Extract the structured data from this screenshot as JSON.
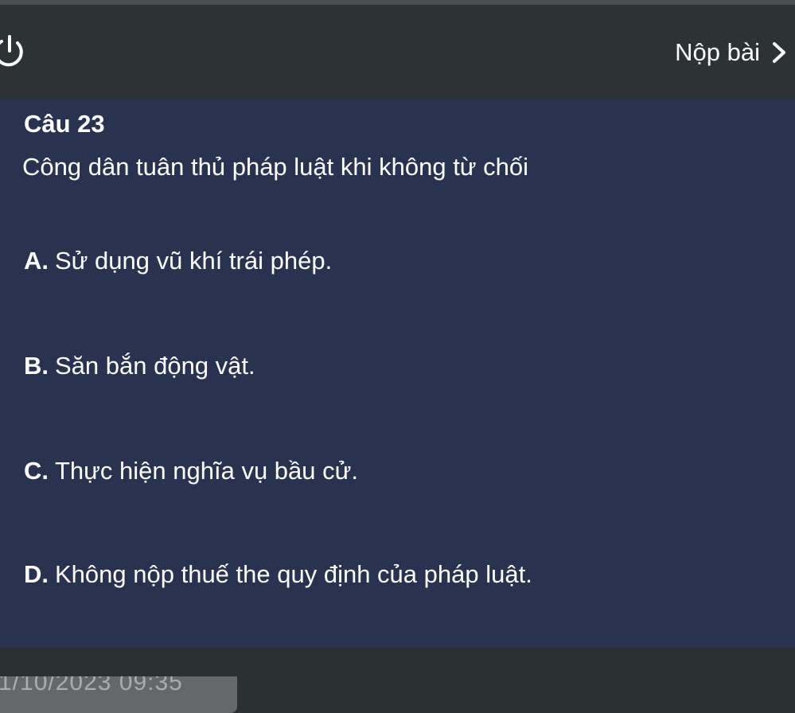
{
  "header": {
    "submit_label": "Nộp bài",
    "power_icon": "power-icon",
    "chevron_icon": "chevron-right-icon"
  },
  "question": {
    "number": "Câu 23",
    "text": "Công dân tuân thủ pháp luật khi không từ chối"
  },
  "options": [
    {
      "letter": "A.",
      "text": "Sử dụng vũ khí trái phép."
    },
    {
      "letter": "B.",
      "text": "Săn bắn động vật."
    },
    {
      "letter": "C.",
      "text": "Thực hiện nghĩa vụ bầu cử."
    },
    {
      "letter": "D.",
      "text": "Không nộp thuế the quy định của pháp luật."
    }
  ],
  "overlay": {
    "timestamp": "1/10/2023 09:35"
  },
  "colors": {
    "topbar": "#2d3234",
    "content": "#293350",
    "text": "#ffffff"
  }
}
